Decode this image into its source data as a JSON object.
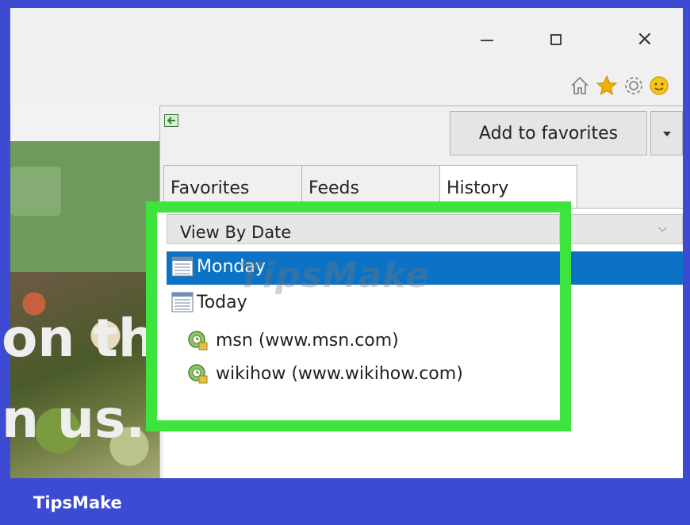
{
  "window": {
    "minimize_glyph": "–",
    "close_glyph": "×"
  },
  "toolbar": {
    "icons": [
      "home-icon",
      "favorites-star-icon",
      "settings-gear-icon",
      "feedback-smiley-icon"
    ]
  },
  "page": {
    "hero_line_1": "on th",
    "hero_line_2": "n us."
  },
  "favorites_center": {
    "add_to_favorites_label": "Add to favorites",
    "tabs": [
      {
        "label": "Favorites"
      },
      {
        "label": "Feeds"
      },
      {
        "label": "History"
      }
    ],
    "active_tab": "History",
    "view_mode": "View By Date",
    "items": [
      {
        "label": "Monday",
        "type": "calendar",
        "selected": true
      },
      {
        "label": "Today",
        "type": "calendar",
        "selected": false
      },
      {
        "label": "msn (www.msn.com)",
        "type": "site",
        "selected": false
      },
      {
        "label": "wikihow (www.wikihow.com)",
        "type": "site",
        "selected": false
      }
    ]
  },
  "colors": {
    "selection": "#0c72c5",
    "highlight_frame": "#3ee43e",
    "banner": "#3c4bd2"
  },
  "watermark": "TipsMake",
  "banner": {
    "text": "TipsMake"
  }
}
